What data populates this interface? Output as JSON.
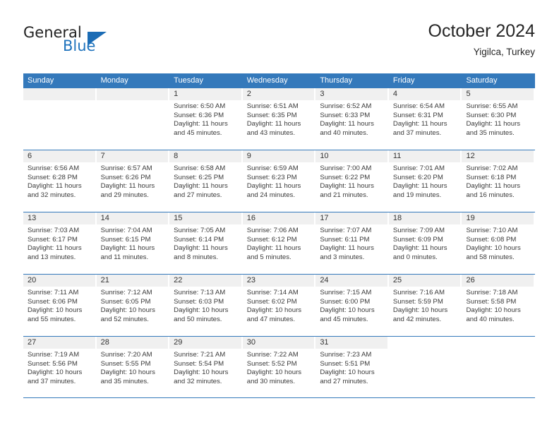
{
  "brand": {
    "name_top": "General",
    "name_bottom": "Blue",
    "triangle_color": "#1b6cb5",
    "blue_color": "#1f73bd"
  },
  "header": {
    "title": "October 2024",
    "subtitle": "Yigilca, Turkey"
  },
  "theme": {
    "header_blue": "#3479bb",
    "date_band": "#f0f0f0",
    "text": "#3a3a3a"
  },
  "weekdays": [
    "Sunday",
    "Monday",
    "Tuesday",
    "Wednesday",
    "Thursday",
    "Friday",
    "Saturday"
  ],
  "weeks": [
    [
      {
        "day": "",
        "lines": []
      },
      {
        "day": "",
        "lines": []
      },
      {
        "day": "1",
        "lines": [
          "Sunrise: 6:50 AM",
          "Sunset: 6:36 PM",
          "Daylight: 11 hours",
          "and 45 minutes."
        ]
      },
      {
        "day": "2",
        "lines": [
          "Sunrise: 6:51 AM",
          "Sunset: 6:35 PM",
          "Daylight: 11 hours",
          "and 43 minutes."
        ]
      },
      {
        "day": "3",
        "lines": [
          "Sunrise: 6:52 AM",
          "Sunset: 6:33 PM",
          "Daylight: 11 hours",
          "and 40 minutes."
        ]
      },
      {
        "day": "4",
        "lines": [
          "Sunrise: 6:54 AM",
          "Sunset: 6:31 PM",
          "Daylight: 11 hours",
          "and 37 minutes."
        ]
      },
      {
        "day": "5",
        "lines": [
          "Sunrise: 6:55 AM",
          "Sunset: 6:30 PM",
          "Daylight: 11 hours",
          "and 35 minutes."
        ]
      }
    ],
    [
      {
        "day": "6",
        "lines": [
          "Sunrise: 6:56 AM",
          "Sunset: 6:28 PM",
          "Daylight: 11 hours",
          "and 32 minutes."
        ]
      },
      {
        "day": "7",
        "lines": [
          "Sunrise: 6:57 AM",
          "Sunset: 6:26 PM",
          "Daylight: 11 hours",
          "and 29 minutes."
        ]
      },
      {
        "day": "8",
        "lines": [
          "Sunrise: 6:58 AM",
          "Sunset: 6:25 PM",
          "Daylight: 11 hours",
          "and 27 minutes."
        ]
      },
      {
        "day": "9",
        "lines": [
          "Sunrise: 6:59 AM",
          "Sunset: 6:23 PM",
          "Daylight: 11 hours",
          "and 24 minutes."
        ]
      },
      {
        "day": "10",
        "lines": [
          "Sunrise: 7:00 AM",
          "Sunset: 6:22 PM",
          "Daylight: 11 hours",
          "and 21 minutes."
        ]
      },
      {
        "day": "11",
        "lines": [
          "Sunrise: 7:01 AM",
          "Sunset: 6:20 PM",
          "Daylight: 11 hours",
          "and 19 minutes."
        ]
      },
      {
        "day": "12",
        "lines": [
          "Sunrise: 7:02 AM",
          "Sunset: 6:18 PM",
          "Daylight: 11 hours",
          "and 16 minutes."
        ]
      }
    ],
    [
      {
        "day": "13",
        "lines": [
          "Sunrise: 7:03 AM",
          "Sunset: 6:17 PM",
          "Daylight: 11 hours",
          "and 13 minutes."
        ]
      },
      {
        "day": "14",
        "lines": [
          "Sunrise: 7:04 AM",
          "Sunset: 6:15 PM",
          "Daylight: 11 hours",
          "and 11 minutes."
        ]
      },
      {
        "day": "15",
        "lines": [
          "Sunrise: 7:05 AM",
          "Sunset: 6:14 PM",
          "Daylight: 11 hours",
          "and 8 minutes."
        ]
      },
      {
        "day": "16",
        "lines": [
          "Sunrise: 7:06 AM",
          "Sunset: 6:12 PM",
          "Daylight: 11 hours",
          "and 5 minutes."
        ]
      },
      {
        "day": "17",
        "lines": [
          "Sunrise: 7:07 AM",
          "Sunset: 6:11 PM",
          "Daylight: 11 hours",
          "and 3 minutes."
        ]
      },
      {
        "day": "18",
        "lines": [
          "Sunrise: 7:09 AM",
          "Sunset: 6:09 PM",
          "Daylight: 11 hours",
          "and 0 minutes."
        ]
      },
      {
        "day": "19",
        "lines": [
          "Sunrise: 7:10 AM",
          "Sunset: 6:08 PM",
          "Daylight: 10 hours",
          "and 58 minutes."
        ]
      }
    ],
    [
      {
        "day": "20",
        "lines": [
          "Sunrise: 7:11 AM",
          "Sunset: 6:06 PM",
          "Daylight: 10 hours",
          "and 55 minutes."
        ]
      },
      {
        "day": "21",
        "lines": [
          "Sunrise: 7:12 AM",
          "Sunset: 6:05 PM",
          "Daylight: 10 hours",
          "and 52 minutes."
        ]
      },
      {
        "day": "22",
        "lines": [
          "Sunrise: 7:13 AM",
          "Sunset: 6:03 PM",
          "Daylight: 10 hours",
          "and 50 minutes."
        ]
      },
      {
        "day": "23",
        "lines": [
          "Sunrise: 7:14 AM",
          "Sunset: 6:02 PM",
          "Daylight: 10 hours",
          "and 47 minutes."
        ]
      },
      {
        "day": "24",
        "lines": [
          "Sunrise: 7:15 AM",
          "Sunset: 6:00 PM",
          "Daylight: 10 hours",
          "and 45 minutes."
        ]
      },
      {
        "day": "25",
        "lines": [
          "Sunrise: 7:16 AM",
          "Sunset: 5:59 PM",
          "Daylight: 10 hours",
          "and 42 minutes."
        ]
      },
      {
        "day": "26",
        "lines": [
          "Sunrise: 7:18 AM",
          "Sunset: 5:58 PM",
          "Daylight: 10 hours",
          "and 40 minutes."
        ]
      }
    ],
    [
      {
        "day": "27",
        "lines": [
          "Sunrise: 7:19 AM",
          "Sunset: 5:56 PM",
          "Daylight: 10 hours",
          "and 37 minutes."
        ]
      },
      {
        "day": "28",
        "lines": [
          "Sunrise: 7:20 AM",
          "Sunset: 5:55 PM",
          "Daylight: 10 hours",
          "and 35 minutes."
        ]
      },
      {
        "day": "29",
        "lines": [
          "Sunrise: 7:21 AM",
          "Sunset: 5:54 PM",
          "Daylight: 10 hours",
          "and 32 minutes."
        ]
      },
      {
        "day": "30",
        "lines": [
          "Sunrise: 7:22 AM",
          "Sunset: 5:52 PM",
          "Daylight: 10 hours",
          "and 30 minutes."
        ]
      },
      {
        "day": "31",
        "lines": [
          "Sunrise: 7:23 AM",
          "Sunset: 5:51 PM",
          "Daylight: 10 hours",
          "and 27 minutes."
        ]
      },
      {
        "day": "",
        "lines": []
      },
      {
        "day": "",
        "lines": []
      }
    ]
  ]
}
